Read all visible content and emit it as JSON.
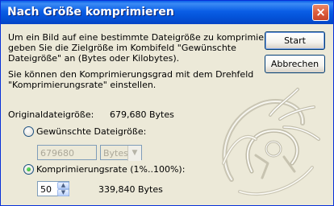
{
  "window": {
    "title": "Nach Größe komprimieren",
    "close_glyph": "×"
  },
  "intro": {
    "line1": "Um ein Bild auf eine bestimmte Dateigröße zu komprimieren,",
    "line2": "geben Sie die Zielgröße im Kombifeld \"Gewünschte",
    "line3": "Dateigröße\" an (Bytes oder Kilobytes).",
    "line4": "Sie können den Komprimierungsgrad mit dem Drehfeld",
    "line5": "\"Komprimierungsrate\" einstellen."
  },
  "buttons": {
    "start": "Start",
    "cancel": "Abbrechen"
  },
  "original": {
    "label": "Originaldateigröße:",
    "value": "679,680 Bytes"
  },
  "desired": {
    "radio_label": "Gewünschte Dateigröße:",
    "selected": false,
    "input_value": "679680",
    "unit": "Bytes"
  },
  "rate": {
    "radio_label": "Komprimierungsrate (1%..100%):",
    "selected": true,
    "value": "50",
    "result": "339,840 Bytes"
  },
  "icons": {
    "close": "close-icon",
    "dropdown": "chevron-down-icon",
    "spin_up": "arrow-up-icon",
    "spin_down": "arrow-down-icon",
    "logo": "jester-logo"
  }
}
